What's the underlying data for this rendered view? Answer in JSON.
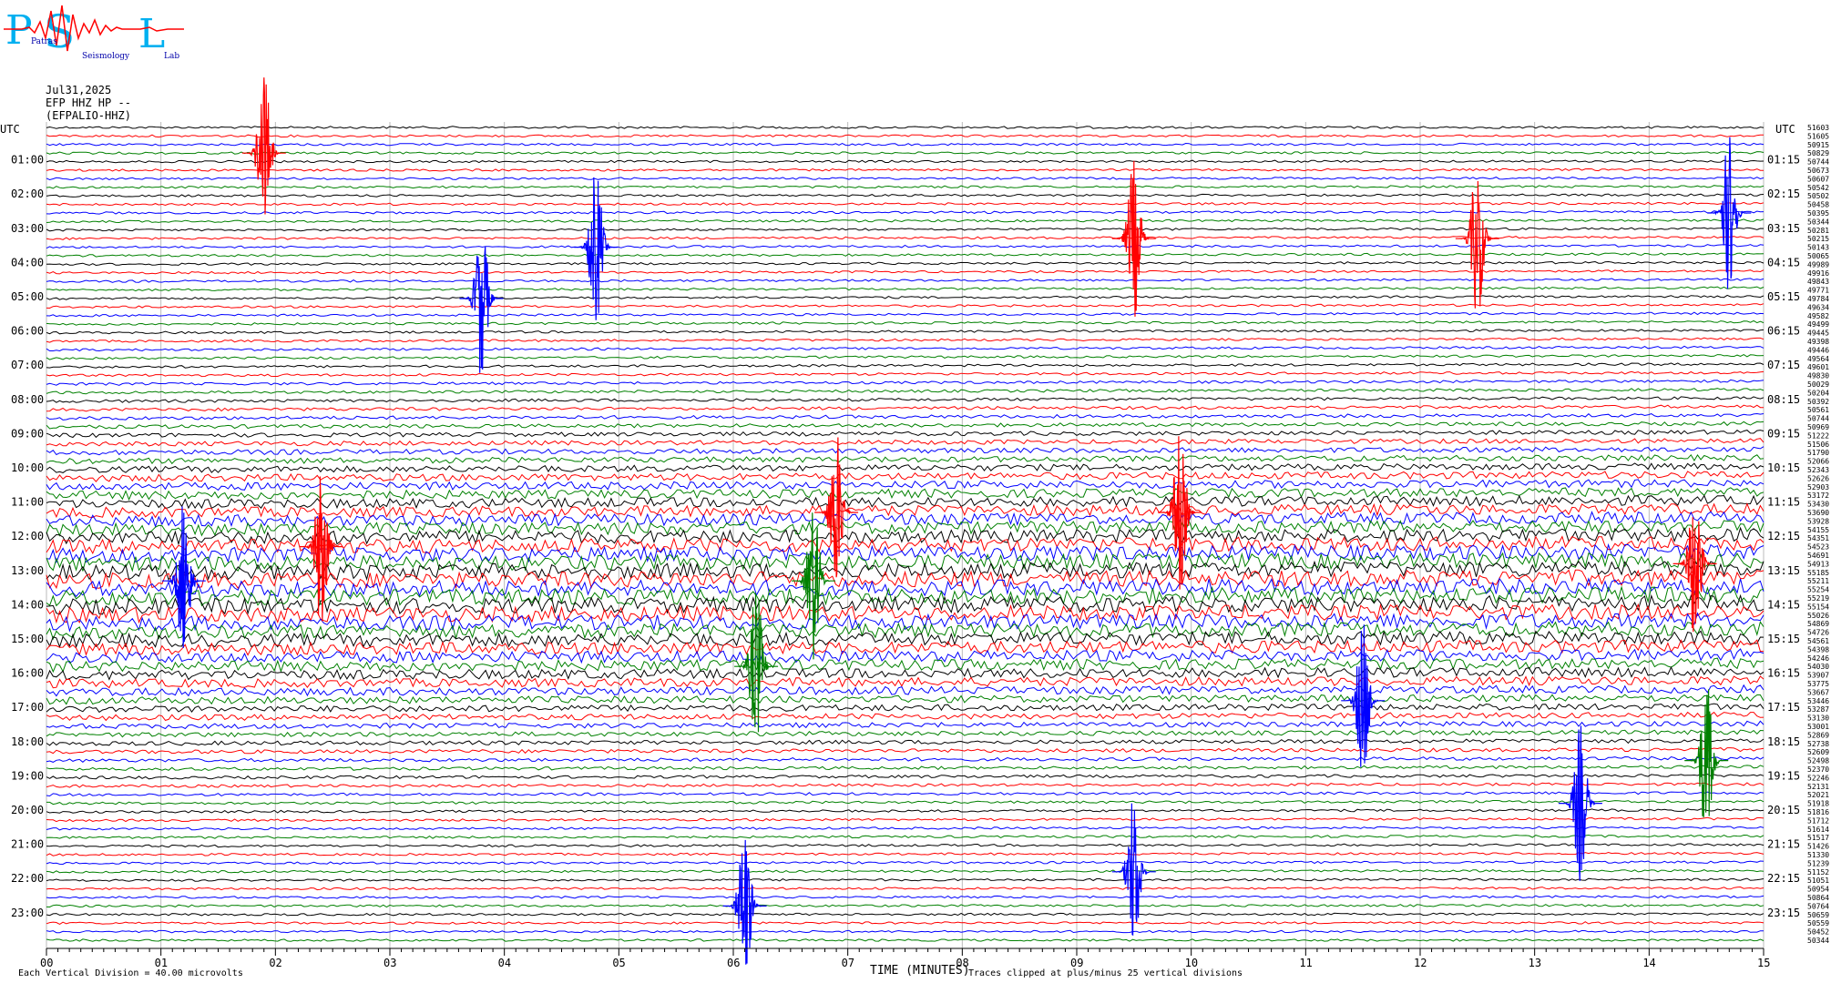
{
  "logo": {
    "text": "PSL",
    "full": "Patras Seismology Lab",
    "words": [
      "Patras",
      "Seismology",
      "Lab"
    ]
  },
  "header": {
    "date": "Jul31,2025",
    "station_line": "EFP HHZ HP --",
    "channel_line": "(EFPALIO-HHZ)"
  },
  "axis": {
    "left_utc": "UTC",
    "right_utc": "UTC",
    "xlabel": "TIME (MINUTES)",
    "xticks": [
      "00",
      "01",
      "02",
      "03",
      "04",
      "05",
      "06",
      "07",
      "08",
      "09",
      "10",
      "11",
      "12",
      "13",
      "14",
      "15"
    ]
  },
  "footer": {
    "scale_note": "Each Vertical Division =   40.00 microvolts",
    "clip_note": "Traces clipped at plus/minus 25 vertical divisions"
  },
  "chart_data": {
    "type": "line",
    "title": "Jul31,2025 EFP HHZ HP -- (EFPALIO-HHZ)",
    "xlabel": "TIME (MINUTES)",
    "xlim": [
      0,
      15
    ],
    "rows_per_hour": 4,
    "row_minutes": 15,
    "colors": [
      "#000000",
      "#ff0000",
      "#0000ff",
      "#008000"
    ],
    "left_labels": [
      "01:00",
      "02:00",
      "03:00",
      "04:00",
      "05:00",
      "06:00",
      "07:00",
      "08:00",
      "09:00",
      "10:00",
      "11:00",
      "12:00",
      "13:00",
      "14:00",
      "15:00",
      "16:00",
      "17:00",
      "18:00",
      "19:00",
      "20:00",
      "21:00",
      "22:00",
      "23:00"
    ],
    "right_labels": [
      "01:15",
      "02:15",
      "03:15",
      "04:15",
      "05:15",
      "06:15",
      "07:15",
      "08:15",
      "09:15",
      "10:15",
      "11:15",
      "12:15",
      "13:15",
      "14:15",
      "15:15",
      "16:15",
      "17:15",
      "18:15",
      "19:15",
      "20:15",
      "21:15",
      "22:15",
      "23:15"
    ],
    "right_counts": [
      "51603",
      "51605",
      "50915",
      "50829",
      "50744",
      "50673",
      "50607",
      "50542",
      "50502",
      "50458",
      "50395",
      "50344",
      "50281",
      "50215",
      "50143",
      "50065",
      "49989",
      "49916",
      "49843",
      "49771",
      "49784",
      "49634",
      "49582",
      "49499",
      "49445",
      "49398",
      "49446",
      "49564",
      "49601",
      "49830",
      "50029",
      "50204",
      "50392",
      "50561",
      "50744",
      "50969",
      "51222",
      "51506",
      "51790",
      "52066",
      "52343",
      "52626",
      "52903",
      "53172",
      "53430",
      "53690",
      "53928",
      "54155",
      "54351",
      "54523",
      "54691",
      "54913",
      "55185",
      "55211",
      "55254",
      "55219",
      "55154",
      "55026",
      "54869",
      "54726",
      "54561",
      "54398",
      "54246",
      "54030",
      "53907",
      "53775",
      "53667",
      "53446",
      "53287",
      "53130",
      "53001",
      "52869",
      "52738",
      "52609",
      "52498",
      "52370",
      "52246",
      "52131",
      "52021",
      "51918",
      "51816",
      "51712",
      "51614",
      "51517",
      "51426",
      "51330",
      "51239",
      "51152",
      "51051",
      "50954",
      "50864",
      "50764",
      "50659",
      "50559",
      "50452",
      "50344"
    ],
    "events": [
      {
        "row": 3,
        "minute": 1.9,
        "color": "#ff0000"
      },
      {
        "row": 14,
        "minute": 4.8,
        "color": "#0000ff"
      },
      {
        "row": 10,
        "minute": 14.7,
        "color": "#0000ff"
      },
      {
        "row": 20,
        "minute": 3.8,
        "color": "#0000ff"
      },
      {
        "row": 13,
        "minute": 9.5,
        "color": "#ff0000"
      },
      {
        "row": 13,
        "minute": 12.5,
        "color": "#ff0000"
      },
      {
        "row": 45,
        "minute": 6.9,
        "color": "#ff0000"
      },
      {
        "row": 45,
        "minute": 9.9,
        "color": "#ff0000"
      },
      {
        "row": 49,
        "minute": 2.4,
        "color": "#ff0000"
      },
      {
        "row": 53,
        "minute": 1.2,
        "color": "#0000ff"
      },
      {
        "row": 53,
        "minute": 6.7,
        "color": "#008000"
      },
      {
        "row": 51,
        "minute": 14.4,
        "color": "#ff0000"
      },
      {
        "row": 63,
        "minute": 6.2,
        "color": "#008000"
      },
      {
        "row": 67,
        "minute": 11.5,
        "color": "#0000ff"
      },
      {
        "row": 74,
        "minute": 14.5,
        "color": "#008000"
      },
      {
        "row": 79,
        "minute": 13.4,
        "color": "#0000ff"
      },
      {
        "row": 87,
        "minute": 9.5,
        "color": "#0000ff"
      },
      {
        "row": 91,
        "minute": 6.1,
        "color": "#0000ff"
      }
    ]
  }
}
